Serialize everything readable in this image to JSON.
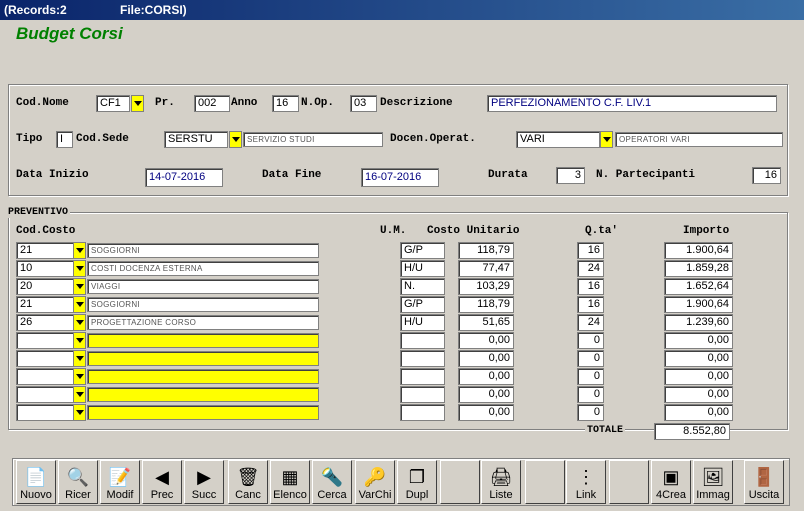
{
  "window": {
    "records": "(Records:2",
    "file": "File:CORSI)"
  },
  "form_title": "Budget Corsi",
  "header": {
    "cod_nome_label": "Cod.Nome",
    "cod_nome": "CF1",
    "pr_label": "Pr.",
    "pr": "002",
    "anno_label": "Anno",
    "anno": "16",
    "nop_label": "N.Op.",
    "nop": "03",
    "descrizione_label": "Descrizione",
    "descrizione": "PERFEZIONAMENTO C.F. LIV.1",
    "tipo_label": "Tipo",
    "tipo": "I",
    "cod_sede_label": "Cod.Sede",
    "cod_sede": "SERSTU",
    "sede_desc": "SERVIZIO STUDI",
    "docen_label": "Docen.Operat.",
    "docen": "VARI",
    "docen_desc": "OPERATORI VARI",
    "data_inizio_label": "Data Inizio",
    "data_inizio": "14-07-2016",
    "data_fine_label": "Data Fine",
    "data_fine": "16-07-2016",
    "durata_label": "Durata",
    "durata": "3",
    "partecipanti_label": "N. Partecipanti",
    "partecipanti": "16"
  },
  "preventivo": {
    "title": "PREVENTIVO",
    "col_cod": "Cod.Costo",
    "col_um": "U.M.",
    "col_costo": "Costo Unitario",
    "col_qta": "Q.ta'",
    "col_importo": "Importo",
    "rows": [
      {
        "cod": "21",
        "desc": "SOGGIORNI",
        "um": "G/P",
        "costo": "118,79",
        "qta": "16",
        "importo": "1.900,64"
      },
      {
        "cod": "10",
        "desc": "COSTI DOCENZA ESTERNA",
        "um": "H/U",
        "costo": "77,47",
        "qta": "24",
        "importo": "1.859,28"
      },
      {
        "cod": "20",
        "desc": "VIAGGI",
        "um": "N.",
        "costo": "103,29",
        "qta": "16",
        "importo": "1.652,64"
      },
      {
        "cod": "21",
        "desc": "SOGGIORNI",
        "um": "G/P",
        "costo": "118,79",
        "qta": "16",
        "importo": "1.900,64"
      },
      {
        "cod": "26",
        "desc": "PROGETTAZIONE CORSO",
        "um": "H/U",
        "costo": "51,65",
        "qta": "24",
        "importo": "1.239,60"
      },
      {
        "cod": "",
        "desc": "",
        "um": "",
        "costo": "0,00",
        "qta": "0",
        "importo": "0,00"
      },
      {
        "cod": "",
        "desc": "",
        "um": "",
        "costo": "0,00",
        "qta": "0",
        "importo": "0,00"
      },
      {
        "cod": "",
        "desc": "",
        "um": "",
        "costo": "0,00",
        "qta": "0",
        "importo": "0,00"
      },
      {
        "cod": "",
        "desc": "",
        "um": "",
        "costo": "0,00",
        "qta": "0",
        "importo": "0,00"
      },
      {
        "cod": "",
        "desc": "",
        "um": "",
        "costo": "0,00",
        "qta": "0",
        "importo": "0,00"
      }
    ],
    "totale_label": "TOTALE",
    "totale": "8.552,80"
  },
  "toolbar": [
    {
      "name": "nuovo-button",
      "icon_name": "new-document-icon",
      "glyph": "📄",
      "label": "Nuovo"
    },
    {
      "name": "ricer-button",
      "icon_name": "search-icon",
      "glyph": "🔍",
      "label": "Ricer"
    },
    {
      "name": "modif-button",
      "icon_name": "edit-icon",
      "glyph": "📝",
      "label": "Modif"
    },
    {
      "name": "prec-button",
      "icon_name": "arrow-left-icon",
      "glyph": "◀",
      "label": "Prec"
    },
    {
      "name": "succ-button",
      "icon_name": "arrow-right-icon",
      "glyph": "▶",
      "label": "Succ"
    },
    {
      "name": "canc-button",
      "icon_name": "trash-icon",
      "glyph": "🗑",
      "label": "Canc"
    },
    {
      "name": "elenco-button",
      "icon_name": "table-icon",
      "glyph": "▦",
      "label": "Elenco"
    },
    {
      "name": "cerca-button",
      "icon_name": "flashlight-icon",
      "glyph": "🔦",
      "label": "Cerca"
    },
    {
      "name": "varchi-button",
      "icon_name": "keys-icon",
      "glyph": "🔑",
      "label": "VarChi"
    },
    {
      "name": "dupl-button",
      "icon_name": "duplicate-icon",
      "glyph": "❐",
      "label": "Dupl"
    },
    {
      "name": "empty-1",
      "icon_name": "",
      "glyph": "",
      "label": ""
    },
    {
      "name": "liste-button",
      "icon_name": "printer-icon",
      "glyph": "🖨",
      "label": "Liste"
    },
    {
      "name": "empty-2",
      "icon_name": "",
      "glyph": "",
      "label": ""
    },
    {
      "name": "link-button",
      "icon_name": "link-tree-icon",
      "glyph": "⋮",
      "label": "Link"
    },
    {
      "name": "empty-3",
      "icon_name": "",
      "glyph": "",
      "label": ""
    },
    {
      "name": "4crea-button",
      "icon_name": "create-icon",
      "glyph": "▣",
      "label": "4Crea"
    },
    {
      "name": "immag-button",
      "icon_name": "image-card-icon",
      "glyph": "🖼",
      "label": "Immag"
    },
    {
      "name": "uscita-button",
      "icon_name": "exit-door-icon",
      "glyph": "🚪",
      "label": "Uscita"
    }
  ]
}
